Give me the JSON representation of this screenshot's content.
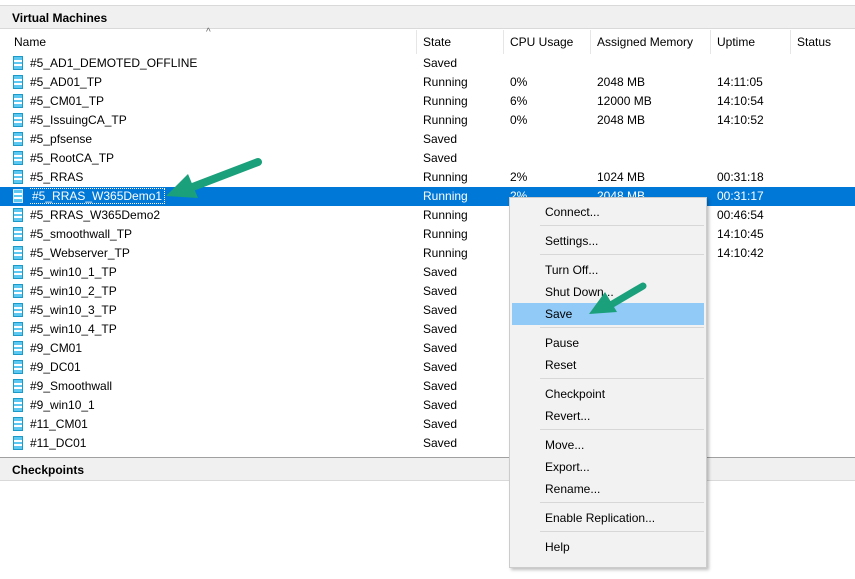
{
  "vm_panel": {
    "title": "Virtual Machines"
  },
  "columns": [
    "Name",
    "State",
    "CPU Usage",
    "Assigned Memory",
    "Uptime",
    "Status"
  ],
  "rows": [
    {
      "name": "#5_AD1_DEMOTED_OFFLINE",
      "state": "Saved",
      "cpu": "",
      "mem": "",
      "uptime": ""
    },
    {
      "name": "#5_AD01_TP",
      "state": "Running",
      "cpu": "0%",
      "mem": "2048 MB",
      "uptime": "14:11:05"
    },
    {
      "name": "#5_CM01_TP",
      "state": "Running",
      "cpu": "6%",
      "mem": "12000 MB",
      "uptime": "14:10:54"
    },
    {
      "name": "#5_IssuingCA_TP",
      "state": "Running",
      "cpu": "0%",
      "mem": "2048 MB",
      "uptime": "14:10:52"
    },
    {
      "name": "#5_pfsense",
      "state": "Saved",
      "cpu": "",
      "mem": "",
      "uptime": ""
    },
    {
      "name": "#5_RootCA_TP",
      "state": "Saved",
      "cpu": "",
      "mem": "",
      "uptime": ""
    },
    {
      "name": "#5_RRAS",
      "state": "Running",
      "cpu": "2%",
      "mem": "1024 MB",
      "uptime": "00:31:18"
    },
    {
      "name": "#5_RRAS_W365Demo1",
      "state": "Running",
      "cpu": "2%",
      "mem": "2048 MB",
      "uptime": "00:31:17",
      "selected": true
    },
    {
      "name": "#5_RRAS_W365Demo2",
      "state": "Running",
      "cpu": "",
      "mem": "",
      "uptime": "00:46:54"
    },
    {
      "name": "#5_smoothwall_TP",
      "state": "Running",
      "cpu": "",
      "mem": "",
      "uptime": "14:10:45"
    },
    {
      "name": "#5_Webserver_TP",
      "state": "Running",
      "cpu": "",
      "mem": "",
      "uptime": "14:10:42"
    },
    {
      "name": "#5_win10_1_TP",
      "state": "Saved",
      "cpu": "",
      "mem": "",
      "uptime": ""
    },
    {
      "name": "#5_win10_2_TP",
      "state": "Saved",
      "cpu": "",
      "mem": "",
      "uptime": ""
    },
    {
      "name": "#5_win10_3_TP",
      "state": "Saved",
      "cpu": "",
      "mem": "",
      "uptime": ""
    },
    {
      "name": "#5_win10_4_TP",
      "state": "Saved",
      "cpu": "",
      "mem": "",
      "uptime": ""
    },
    {
      "name": "#9_CM01",
      "state": "Saved",
      "cpu": "",
      "mem": "",
      "uptime": ""
    },
    {
      "name": "#9_DC01",
      "state": "Saved",
      "cpu": "",
      "mem": "",
      "uptime": ""
    },
    {
      "name": "#9_Smoothwall",
      "state": "Saved",
      "cpu": "",
      "mem": "",
      "uptime": ""
    },
    {
      "name": "#9_win10_1",
      "state": "Saved",
      "cpu": "",
      "mem": "",
      "uptime": ""
    },
    {
      "name": "#11_CM01",
      "state": "Saved",
      "cpu": "",
      "mem": "",
      "uptime": ""
    },
    {
      "name": "#11_DC01",
      "state": "Saved",
      "cpu": "",
      "mem": "",
      "uptime": ""
    }
  ],
  "checkpoints_panel": {
    "title": "Checkpoints"
  },
  "context_menu": [
    {
      "label": "Connect..."
    },
    {
      "label": "Settings..."
    },
    {
      "label": "Turn Off..."
    },
    {
      "label": "Shut Down..."
    },
    {
      "label": "Save",
      "hover": true
    },
    {
      "label": "Pause"
    },
    {
      "label": "Reset"
    },
    {
      "label": "Checkpoint"
    },
    {
      "label": "Revert..."
    },
    {
      "label": "Move..."
    },
    {
      "label": "Export..."
    },
    {
      "label": "Rename..."
    },
    {
      "label": "Enable Replication..."
    },
    {
      "label": "Help"
    }
  ],
  "colors": {
    "selection": "#0078d7",
    "menu_hover": "#91c9f7",
    "arrow": "#1aa07a"
  },
  "icons": {
    "vm": "virtual-machine-icon",
    "arrow": "green-pointer-arrow-icon"
  }
}
